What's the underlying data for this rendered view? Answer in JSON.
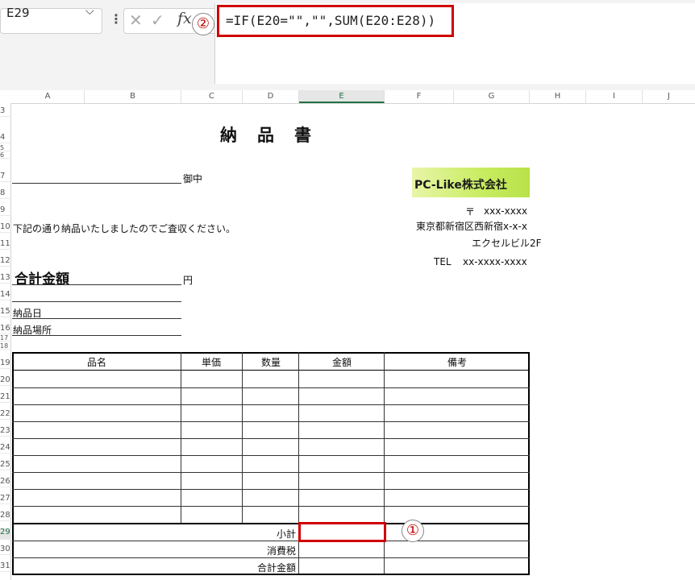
{
  "formula_bar": {
    "name_box": "E29",
    "chevron": "⌵",
    "more": "⋮",
    "cancel_glyph": "✕",
    "enter_glyph": "✓",
    "fx_glyph": "fx",
    "formula": "=IF(E20=\"\",\"\",SUM(E20:E28))",
    "callout": "②"
  },
  "columns": [
    "A",
    "B",
    "C",
    "D",
    "E",
    "F",
    "G",
    "H",
    "I",
    "J"
  ],
  "selected_column": "E",
  "rows": [
    "3",
    "4",
    "5",
    "6",
    "7",
    "8",
    "9",
    "10",
    "11",
    "12",
    "13",
    "14",
    "15",
    "16",
    "17",
    "18",
    "19",
    "20",
    "21",
    "22",
    "23",
    "24",
    "25",
    "26",
    "27",
    "28",
    "29",
    "30",
    "31"
  ],
  "selected_row": "29",
  "document": {
    "title": "納　品　書",
    "recipient_suffix": "御中",
    "intro": "下記の通り納品いたしましたのでご査収ください。",
    "total_label": "合計金額",
    "yen": "円",
    "delivery_date": "納品日",
    "delivery_place": "納品場所",
    "company": {
      "logo": "PC-Like株式会社",
      "postal_mark": "〒",
      "postal": "xxx-xxxx",
      "address1": "東京都新宿区西新宿x-x-x",
      "address2": "エクセルビル2F",
      "tel_label": "TEL",
      "tel": "xx-xxxx-xxxx"
    },
    "table_headers": [
      "品名",
      "単価",
      "数量",
      "金額",
      "備考"
    ],
    "subtotal": "小計",
    "tax": "消費税",
    "grand_total": "合計金額"
  },
  "callout_1": "①"
}
